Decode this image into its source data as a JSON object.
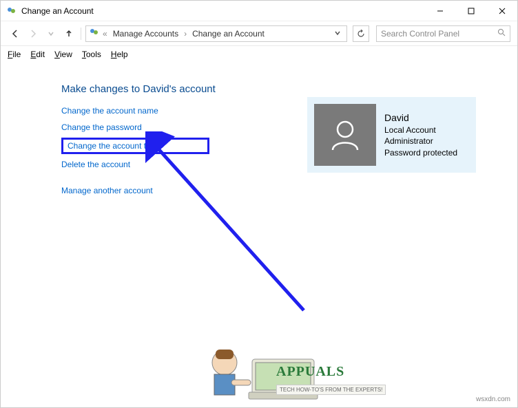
{
  "titlebar": {
    "title": "Change an Account"
  },
  "breadcrumb": {
    "back_sep": "«",
    "item1": "Manage Accounts",
    "item2": "Change an Account"
  },
  "search": {
    "placeholder": "Search Control Panel"
  },
  "menu": {
    "file": "File",
    "edit": "Edit",
    "view": "View",
    "tools": "Tools",
    "help": "Help"
  },
  "heading": "Make changes to David's account",
  "links": {
    "name": "Change the account name",
    "password": "Change the password",
    "type": "Change the account type",
    "delete": "Delete the account",
    "manage": "Manage another account"
  },
  "account": {
    "name": "David",
    "type": "Local Account",
    "role": "Administrator",
    "protection": "Password protected"
  },
  "branding": {
    "name": "APPUALS",
    "tag": "TECH HOW-TO'S FROM THE EXPERTS!"
  },
  "watermark": "wsxdn.com"
}
